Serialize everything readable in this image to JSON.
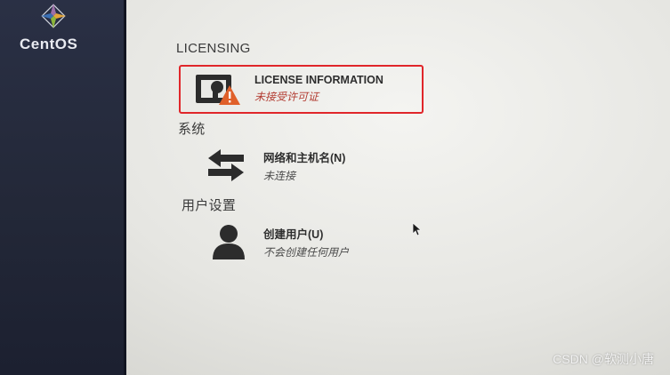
{
  "sidebar": {
    "brand": "CentOS"
  },
  "sections": {
    "licensing": "LICENSING",
    "system": "系统",
    "user_settings": "用户设置"
  },
  "spokes": {
    "license": {
      "name": "LICENSE INFORMATION",
      "status": "未接受许可证"
    },
    "network": {
      "name": "网络和主机名(N)",
      "status": "未连接"
    },
    "user": {
      "name": "创建用户(U)",
      "status": "不会创建任何用户"
    }
  },
  "watermark": "CSDN @软测小唐",
  "colors": {
    "warning": "#b23a30",
    "highlight": "#e0262a",
    "sidebar": "#252a3c"
  },
  "icons": [
    "centos-logo-icon",
    "license-warning-icon",
    "network-arrows-icon",
    "user-icon",
    "mouse-cursor-icon"
  ]
}
